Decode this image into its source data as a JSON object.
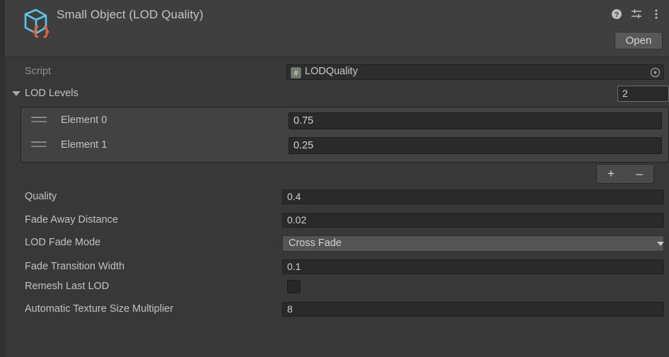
{
  "header": {
    "title": "Small Object (LOD Quality)",
    "icon": "scriptable-object-cube-icon",
    "help_icon": "help-icon",
    "preset_icon": "preset-settings-icon",
    "menu_icon": "kebab-menu-icon",
    "open_label": "Open"
  },
  "script_row": {
    "label": "Script",
    "value": "LODQuality",
    "icon": "csharp-script-icon",
    "picker_icon": "object-picker-icon"
  },
  "array": {
    "label": "LOD Levels",
    "size": "2",
    "foldout_icon": "foldout-expanded-icon",
    "elements": [
      {
        "label": "Element 0",
        "value": "0.75",
        "handle_icon": "drag-handle-icon"
      },
      {
        "label": "Element 1",
        "value": "0.25",
        "handle_icon": "drag-handle-icon"
      }
    ],
    "add_label": "+",
    "remove_label": "–"
  },
  "properties": [
    {
      "label": "Quality",
      "value": "0.4",
      "type": "number"
    },
    {
      "label": "Fade Away Distance",
      "value": "0.02",
      "type": "number"
    },
    {
      "label": "LOD Fade Mode",
      "value": "Cross Fade",
      "type": "dropdown"
    },
    {
      "label": "Fade Transition Width",
      "value": "0.1",
      "type": "number"
    },
    {
      "label": "Remesh Last LOD",
      "value": "",
      "type": "checkbox",
      "checked": false
    },
    {
      "label": "Automatic Texture Size Multiplier",
      "value": "8",
      "type": "number"
    }
  ],
  "colors": {
    "background": "#383838",
    "header": "#3f3f3f",
    "field": "#2a2a2a",
    "dropdown": "#545454",
    "array_box": "#424242",
    "icon_blue": "#5ec4e8",
    "icon_orange": "#e8603c"
  }
}
